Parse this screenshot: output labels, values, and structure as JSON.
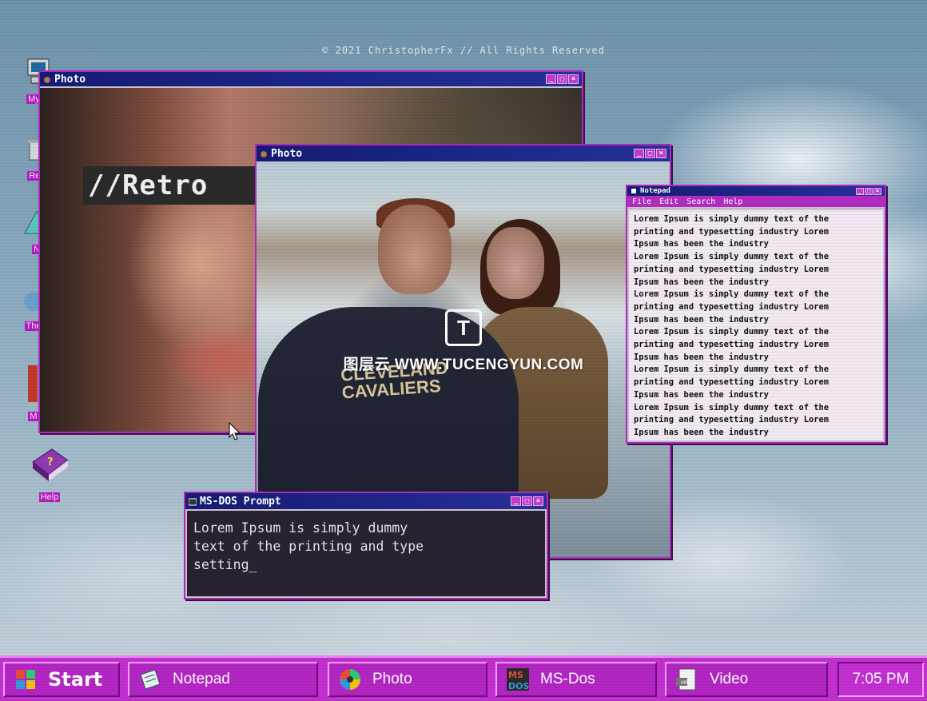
{
  "copyright": "© 2021 ChristopherFx // All Rights Reserved",
  "desktop_icons": [
    {
      "label": "My C",
      "icon": "computer-icon"
    },
    {
      "label": "Rec",
      "icon": "recycle-bin-icon"
    },
    {
      "label": "N",
      "icon": "network-icon"
    },
    {
      "label": "The",
      "icon": "internet-icon"
    },
    {
      "label": "M",
      "icon": "mail-icon"
    },
    {
      "label": "Help",
      "icon": "help-book-icon"
    }
  ],
  "photo_window_back": {
    "title": "Photo",
    "overlay_text": "//Retro"
  },
  "photo_window_front": {
    "title": "Photo",
    "shirt_text_line1": "CLEVELAND",
    "shirt_text_line2": "CAVALIERS"
  },
  "notepad": {
    "title": "Notepad",
    "menu": [
      "File",
      "Edit",
      "Search",
      "Help"
    ],
    "lines": [
      "Lorem Ipsum is simply dummy text of the",
      "printing and typesetting industry Lorem",
      "Ipsum has been the industry",
      "Lorem Ipsum is simply dummy text of the",
      "printing and typesetting industry Lorem",
      "Ipsum has been the industry",
      "Lorem Ipsum is simply dummy text of the",
      "printing and typesetting industry Lorem",
      "Ipsum has been the industry",
      "Lorem Ipsum is simply dummy text of the",
      "printing and typesetting industry Lorem",
      "Ipsum has been the industry",
      "Lorem Ipsum is simply dummy text of the",
      "printing and typesetting industry Lorem",
      "Ipsum has been the industry",
      "Lorem Ipsum is simply dummy text of the",
      "printing and typesetting industry Lorem",
      "Ipsum has been the industry"
    ]
  },
  "msdos": {
    "title": "MS-DOS Prompt",
    "text": "Lorem Ipsum is simply dummy\ntext of the printing and type\nsetting_"
  },
  "watermark": {
    "logo": "T",
    "text": "图层云 WWW.TUCENGYUN.COM"
  },
  "taskbar": {
    "start_label": "Start",
    "buttons": [
      {
        "label": "Notepad",
        "icon": "notepad-icon"
      },
      {
        "label": "Photo",
        "icon": "photo-icon"
      },
      {
        "label": "MS-Dos",
        "icon": "msdos-icon"
      },
      {
        "label": "Video",
        "icon": "video-icon"
      }
    ],
    "clock": "7:05 PM"
  },
  "colors": {
    "accent": "#c42fd2",
    "titlebar": "#141c73"
  }
}
